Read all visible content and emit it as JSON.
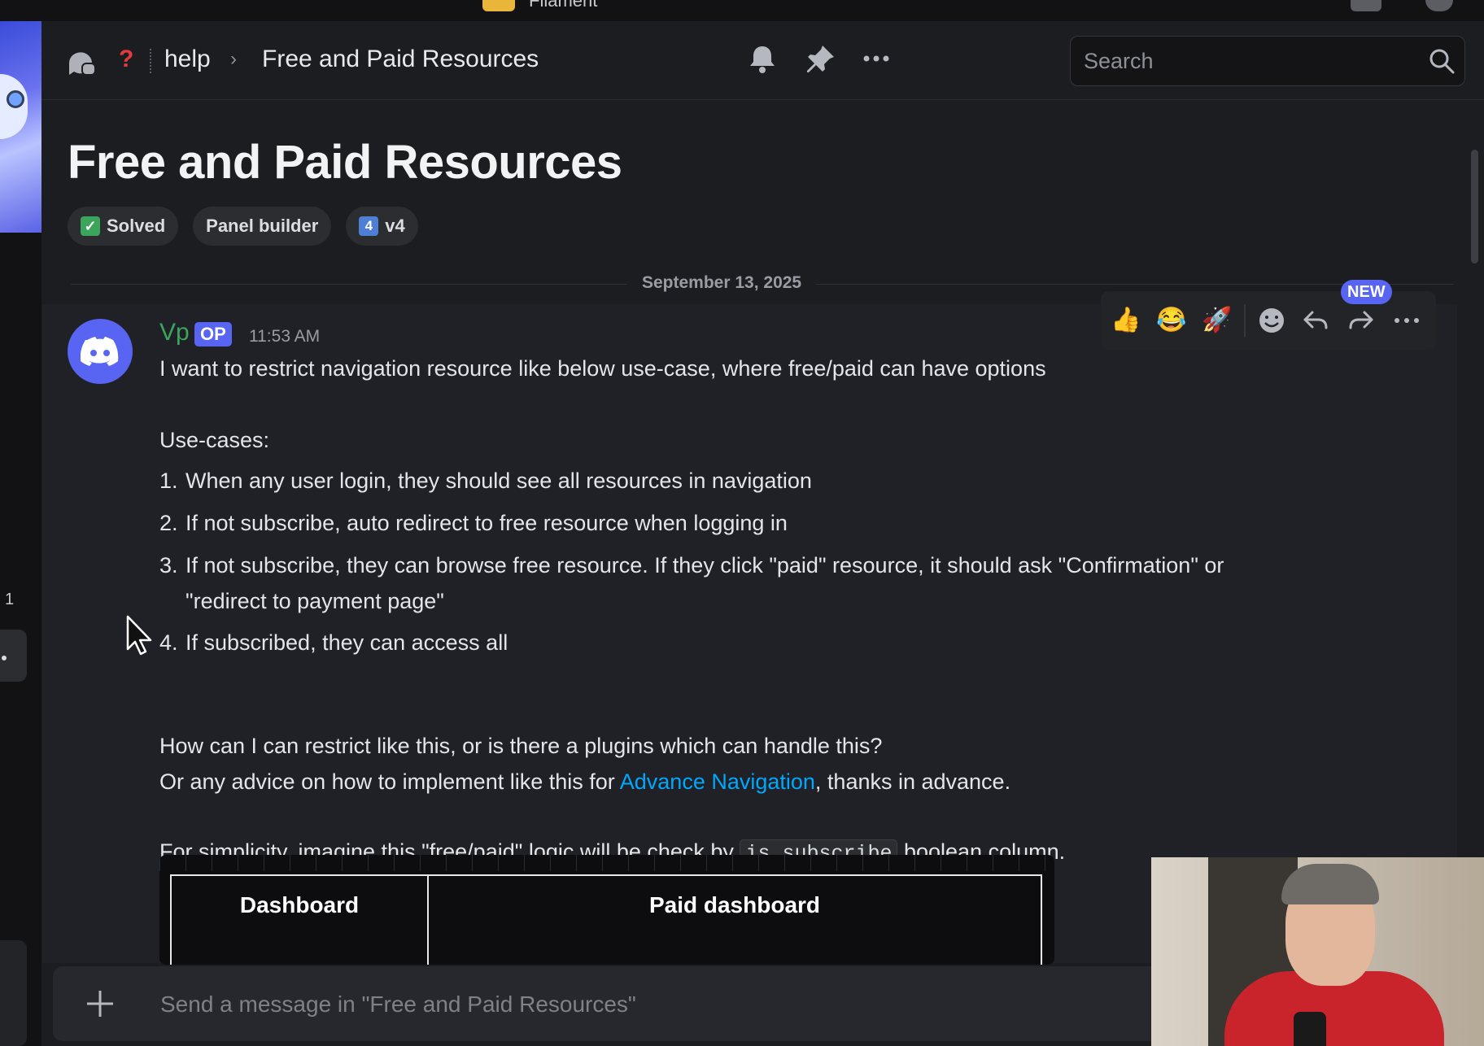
{
  "top_bar": {
    "app_name": "Filament"
  },
  "sidebar": {
    "unread_count": "1"
  },
  "header": {
    "breadcrumb_channel": "help",
    "breadcrumb_thread": "Free and Paid Resources",
    "search_placeholder": "Search"
  },
  "thread": {
    "title": "Free and Paid Resources",
    "tags": [
      {
        "label": "Solved",
        "icon": "check-mark-icon"
      },
      {
        "label": "Panel builder"
      },
      {
        "label": "v4",
        "icon_text": "4"
      }
    ],
    "date_divider": "September 13, 2025"
  },
  "message": {
    "author": "Vp",
    "badge": "OP",
    "timestamp": "11:53 AM",
    "intro": "I want to restrict navigation resource like below use-case, where free/paid can have options",
    "use_cases_heading": "Use-cases:",
    "use_cases": [
      {
        "num": "1.",
        "text": "When any user login, they should see all resources in navigation"
      },
      {
        "num": "2.",
        "text": "If not subscribe, auto redirect to free resource when logging in"
      },
      {
        "num": "3.",
        "text": "If not subscribe, they can browse free resource. If they click \"paid\" resource, it should ask \"Confirmation\" or",
        "text_cont": "\"redirect to payment page\""
      },
      {
        "num": "4.",
        "text": "If subscribed, they can access all"
      }
    ],
    "question": "How can I can restrict like this, or is there a plugins which can handle this?",
    "advice_prefix": "Or any advice on how to implement like this for ",
    "advice_link": "Advance Navigation",
    "advice_suffix": ", thanks in advance.",
    "simplicity_prefix": "For simplicity, imagine this \"free/paid\" logic will be check by ",
    "simplicity_code": "is_subscribe",
    "simplicity_suffix": " boolean column.",
    "embed_cells": [
      "Dashboard",
      "Paid dashboard"
    ]
  },
  "reaction_toolbar": {
    "new_badge": "NEW",
    "quick_reactions": [
      "👍",
      "😂",
      "🚀"
    ]
  },
  "composer": {
    "placeholder": "Send a message in \"Free and Paid Resources\""
  },
  "colors": {
    "accent": "#5865f2",
    "author": "#3ba55c",
    "link": "#00a8fc",
    "solved": "#3ba55c"
  }
}
